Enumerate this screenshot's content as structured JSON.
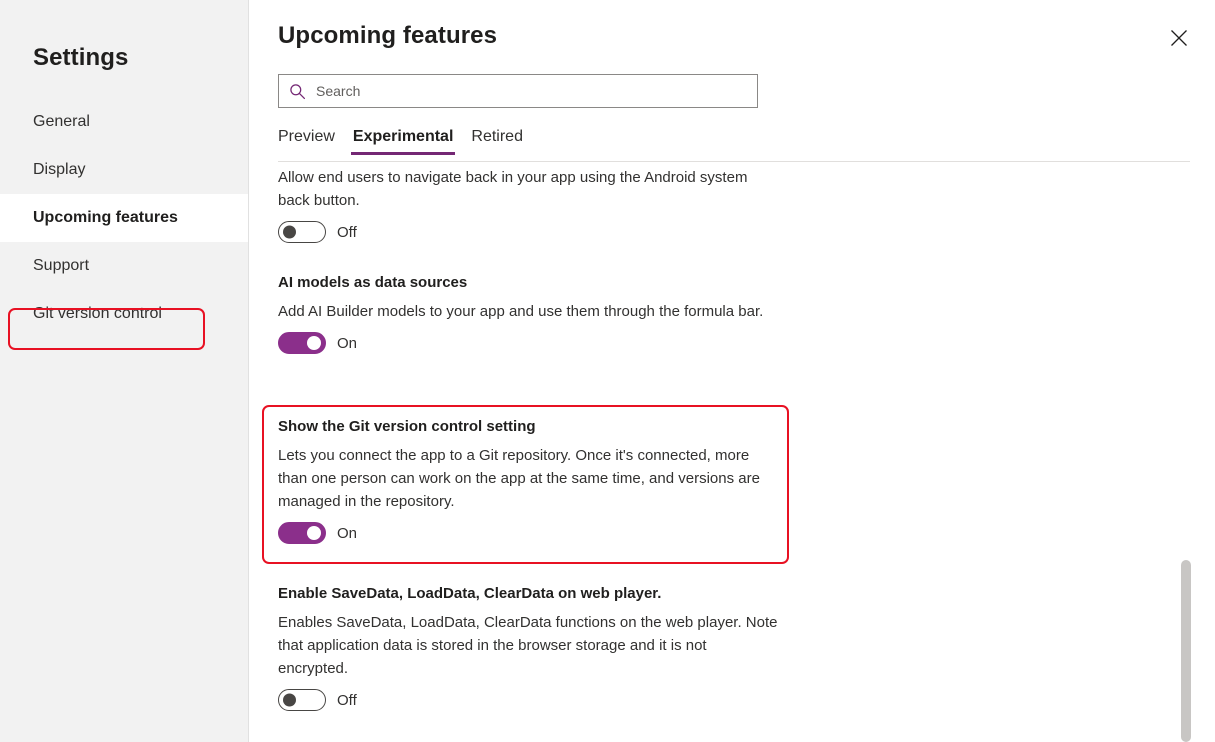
{
  "sidebar": {
    "title": "Settings",
    "items": [
      {
        "label": "General",
        "selected": false
      },
      {
        "label": "Display",
        "selected": false
      },
      {
        "label": "Upcoming features",
        "selected": true
      },
      {
        "label": "Support",
        "selected": false
      },
      {
        "label": "Git version control",
        "selected": false,
        "highlighted": true
      }
    ]
  },
  "header": {
    "title": "Upcoming features",
    "close_icon": "close-icon"
  },
  "search": {
    "placeholder": "Search",
    "value": "",
    "icon": "search-icon"
  },
  "tabs": [
    {
      "label": "Preview",
      "active": false
    },
    {
      "label": "Experimental",
      "active": true
    },
    {
      "label": "Retired",
      "active": false
    }
  ],
  "features": [
    {
      "title": "",
      "description": "Allow end users to navigate back in your app using the Android system back button.",
      "toggle_state": "Off",
      "toggle_on": false
    },
    {
      "title": "AI models as data sources",
      "description": "Add AI Builder models to your app and use them through the formula bar.",
      "toggle_state": "On",
      "toggle_on": true
    },
    {
      "title": "Show the Git version control setting",
      "description": "Lets you connect the app to a Git repository. Once it's connected, more than one person can work on the app at the same time, and versions are managed in the repository.",
      "toggle_state": "On",
      "toggle_on": true,
      "highlighted": true
    },
    {
      "title": "Enable SaveData, LoadData, ClearData on web player.",
      "description": "Enables SaveData, LoadData, ClearData functions on the web player. Note that application data is stored in the browser storage and it is not encrypted.",
      "toggle_state": "Off",
      "toggle_on": false
    }
  ],
  "colors": {
    "accent": "#742774",
    "toggle_on": "#8b2f8b",
    "highlight": "#e81123",
    "sidebar_bg": "#f2f2f2",
    "scrollbar": "#c8c6c4"
  }
}
